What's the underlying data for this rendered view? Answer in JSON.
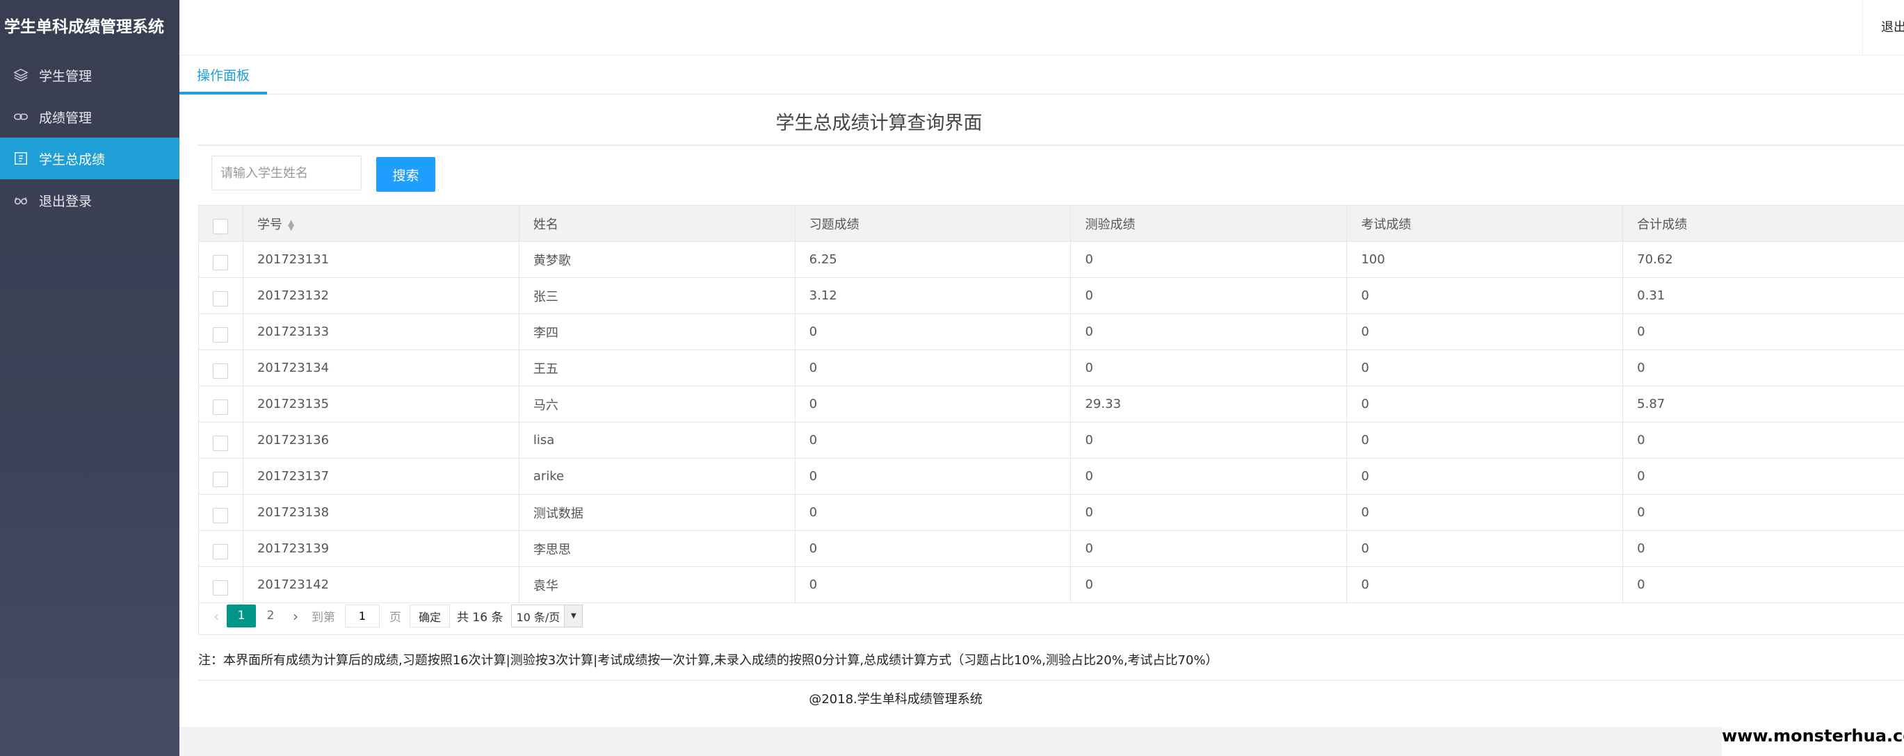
{
  "app_title": "学生单科成绩管理系统",
  "header": {
    "logout_label": "退出"
  },
  "sidebar": {
    "items": [
      {
        "label": "学生管理",
        "icon": "layers-icon",
        "active": false
      },
      {
        "label": "成绩管理",
        "icon": "link-icon",
        "active": false
      },
      {
        "label": "学生总成绩",
        "icon": "document-icon",
        "active": true
      },
      {
        "label": "退出登录",
        "icon": "glasses-icon",
        "active": false
      }
    ]
  },
  "tabs": [
    {
      "label": "操作面板"
    }
  ],
  "main": {
    "title": "学生总成绩计算查询界面",
    "search": {
      "placeholder": "请输入学生姓名",
      "value": "",
      "button_label": "搜索"
    }
  },
  "table": {
    "columns": [
      "学号",
      "姓名",
      "习题成绩",
      "测验成绩",
      "考试成绩",
      "合计成绩"
    ],
    "rows": [
      [
        "201723131",
        "黄梦歌",
        "6.25",
        "0",
        "100",
        "70.62"
      ],
      [
        "201723132",
        "张三",
        "3.12",
        "0",
        "0",
        "0.31"
      ],
      [
        "201723133",
        "李四",
        "0",
        "0",
        "0",
        "0"
      ],
      [
        "201723134",
        "王五",
        "0",
        "0",
        "0",
        "0"
      ],
      [
        "201723135",
        "马六",
        "0",
        "29.33",
        "0",
        "5.87"
      ],
      [
        "201723136",
        "lisa",
        "0",
        "0",
        "0",
        "0"
      ],
      [
        "201723137",
        "arike",
        "0",
        "0",
        "0",
        "0"
      ],
      [
        "201723138",
        "测试数据",
        "0",
        "0",
        "0",
        "0"
      ],
      [
        "201723139",
        "李思思",
        "0",
        "0",
        "0",
        "0"
      ],
      [
        "201723142",
        "袁华",
        "0",
        "0",
        "0",
        "0"
      ]
    ]
  },
  "pagination": {
    "pages": [
      "1",
      "2"
    ],
    "current": "1",
    "goto_label": "到第",
    "goto_value": "1",
    "page_unit": "页",
    "confirm_label": "确定",
    "total_label": "共 16 条",
    "page_size_label": "10 条/页"
  },
  "note": "注：本界面所有成绩为计算后的成绩,习题按照16次计算|测验按3次计算|考试成绩按一次计算,未录入成绩的按照0分计算,总成绩计算方式（习题占比10%,测验占比20%,考试占比70%）",
  "copyright": "@2018.学生单科成绩管理系统",
  "watermark": "www.monsterhua.com",
  "colors": {
    "accent": "#1e9fd8",
    "search_button": "#1e9fff",
    "current_page": "#009688",
    "sidebar_bg": "#3e4258"
  }
}
